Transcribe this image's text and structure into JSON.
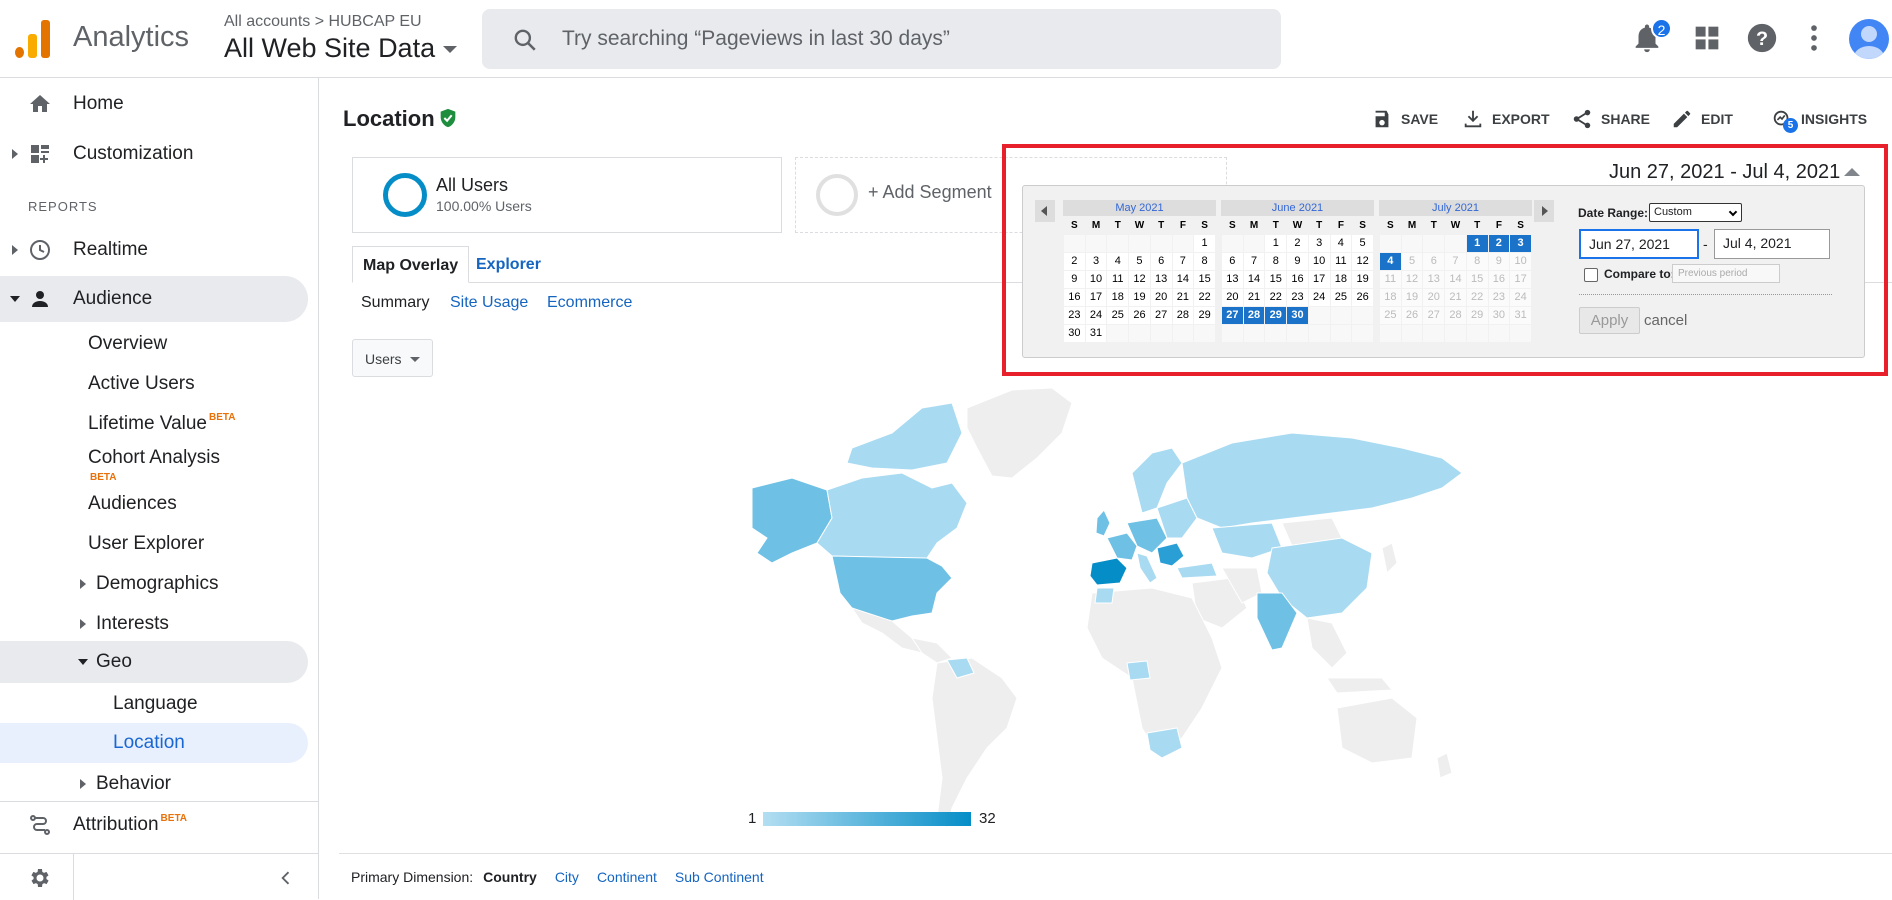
{
  "header": {
    "product": "Analytics",
    "account_crumb": "All accounts > HUBCAP EU",
    "view": "All Web Site Data",
    "search_placeholder": "Try searching “Pageviews in last 30 days”",
    "notifications": "2"
  },
  "sidebar": {
    "home": "Home",
    "customization": "Customization",
    "reports_header": "REPORTS",
    "realtime": "Realtime",
    "audience": "Audience",
    "overview": "Overview",
    "active_users": "Active Users",
    "lifetime_value": "Lifetime Value",
    "cohort_analysis": "Cohort Analysis",
    "audiences": "Audiences",
    "user_explorer": "User Explorer",
    "demographics": "Demographics",
    "interests": "Interests",
    "geo": "Geo",
    "language": "Language",
    "location": "Location",
    "behavior": "Behavior",
    "attribution": "Attribution",
    "beta": "BETA"
  },
  "page": {
    "title": "Location",
    "actions": {
      "save": "SAVE",
      "export": "EXPORT",
      "share": "SHARE",
      "edit": "EDIT",
      "insights": "INSIGHTS",
      "insights_badge": "5"
    }
  },
  "segments": {
    "all_users": "All Users",
    "all_users_pct": "100.00% Users",
    "add_segment": "+ Add Segment"
  },
  "tabs": {
    "map_overlay": "Map Overlay",
    "explorer": "Explorer"
  },
  "subtabs": {
    "summary": "Summary",
    "site_usage": "Site Usage",
    "ecommerce": "Ecommerce"
  },
  "metric_selector": "Users",
  "map_legend": {
    "min": "1",
    "max": "32"
  },
  "primary_dimension": {
    "label": "Primary Dimension:",
    "country": "Country",
    "city": "City",
    "continent": "Continent",
    "sub_continent": "Sub Continent"
  },
  "date_range": {
    "display": "Jun 27, 2021 - Jul 4, 2021",
    "range_label": "Date Range:",
    "range_type": "Custom",
    "start": "Jun 27, 2021",
    "end": "Jul 4, 2021",
    "dash": "-",
    "compare_label": "Compare to:",
    "compare_option": "Previous period",
    "apply": "Apply",
    "cancel": "cancel"
  },
  "calendar": {
    "weekdays": [
      "S",
      "M",
      "T",
      "W",
      "T",
      "F",
      "S"
    ],
    "months": [
      {
        "name": "May 2021",
        "weeks": [
          [
            "",
            "",
            "",
            "",
            "",
            "",
            "1"
          ],
          [
            "2",
            "3",
            "4",
            "5",
            "6",
            "7",
            "8"
          ],
          [
            "9",
            "10",
            "11",
            "12",
            "13",
            "14",
            "15"
          ],
          [
            "16",
            "17",
            "18",
            "19",
            "20",
            "21",
            "22"
          ],
          [
            "23",
            "24",
            "25",
            "26",
            "27",
            "28",
            "29"
          ],
          [
            "30",
            "31",
            "",
            "",
            "",
            "",
            ""
          ]
        ]
      },
      {
        "name": "June 2021",
        "weeks": [
          [
            "",
            "",
            "1",
            "2",
            "3",
            "4",
            "5"
          ],
          [
            "6",
            "7",
            "8",
            "9",
            "10",
            "11",
            "12"
          ],
          [
            "13",
            "14",
            "15",
            "16",
            "17",
            "18",
            "19"
          ],
          [
            "20",
            "21",
            "22",
            "23",
            "24",
            "25",
            "26"
          ],
          [
            "27",
            "28",
            "29",
            "30",
            "",
            "",
            ""
          ],
          [
            "",
            "",
            "",
            "",
            "",
            "",
            ""
          ]
        ]
      },
      {
        "name": "July 2021",
        "weeks": [
          [
            "",
            "",
            "",
            "",
            "1",
            "2",
            "3"
          ],
          [
            "4",
            "5",
            "6",
            "7",
            "8",
            "9",
            "10"
          ],
          [
            "11",
            "12",
            "13",
            "14",
            "15",
            "16",
            "17"
          ],
          [
            "18",
            "19",
            "20",
            "21",
            "22",
            "23",
            "24"
          ],
          [
            "25",
            "26",
            "27",
            "28",
            "29",
            "30",
            "31"
          ],
          [
            "",
            "",
            "",
            "",
            "",
            "",
            ""
          ]
        ]
      }
    ],
    "selected": {
      "June 2021": [
        "27",
        "28",
        "29",
        "30"
      ],
      "July 2021": [
        "1",
        "2",
        "3",
        "4"
      ]
    },
    "future_after": {
      "July 2021": 4
    }
  },
  "colors": {
    "accent": "#1a73e8",
    "map_low": "#b3def2",
    "map_high": "#058dc7",
    "highlight_box": "#e8202c"
  }
}
